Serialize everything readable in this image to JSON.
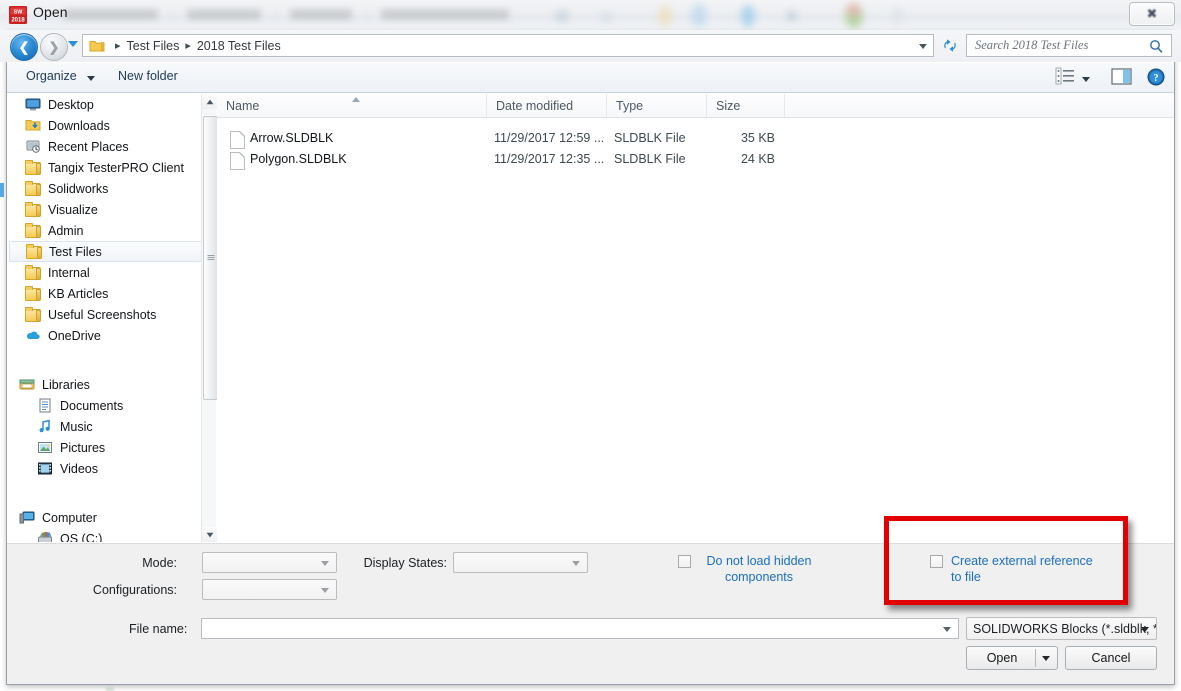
{
  "window": {
    "title": "Open",
    "title_icon": "solidworks-2018-icon",
    "close_label": "✖"
  },
  "address_bar": {
    "back_icon": "back-arrow-icon",
    "forward_icon": "forward-arrow-icon",
    "history_icon": "history-dropdown-icon",
    "folder_icon": "folder-icon",
    "separator": "▸",
    "crumbs": [
      "Test Files",
      "2018 Test Files"
    ],
    "refresh_icon": "refresh-icon",
    "search_placeholder": "Search 2018 Test Files",
    "search_icon": "search-icon"
  },
  "toolbar": {
    "organize_label": "Organize",
    "organize_caret_icon": "chevron-down-icon",
    "new_folder_label": "New folder",
    "view_icon": "view-list-icon",
    "view_caret_icon": "chevron-down-icon",
    "preview_pane_icon": "preview-pane-icon",
    "help_icon": "help-icon"
  },
  "nav_pane": {
    "groups": [
      {
        "items": [
          {
            "label": "Desktop",
            "icon": "desktop-icon",
            "indent": 0,
            "selected": false
          },
          {
            "label": "Downloads",
            "icon": "downloads-folder-icon",
            "indent": 0,
            "selected": false
          },
          {
            "label": "Recent Places",
            "icon": "recent-places-icon",
            "indent": 0,
            "selected": false
          },
          {
            "label": "Tangix TesterPRO Client",
            "icon": "folder-icon",
            "indent": 0,
            "selected": false
          },
          {
            "label": "Solidworks",
            "icon": "folder-icon",
            "indent": 0,
            "selected": false
          },
          {
            "label": "Visualize",
            "icon": "folder-icon",
            "indent": 0,
            "selected": false
          },
          {
            "label": "Admin",
            "icon": "folder-icon",
            "indent": 0,
            "selected": false
          },
          {
            "label": "Test Files",
            "icon": "folder-icon",
            "indent": 0,
            "selected": true
          },
          {
            "label": "Internal",
            "icon": "folder-icon",
            "indent": 0,
            "selected": false
          },
          {
            "label": "KB Articles",
            "icon": "folder-icon",
            "indent": 0,
            "selected": false
          },
          {
            "label": "Useful Screenshots",
            "icon": "folder-icon",
            "indent": 0,
            "selected": false
          },
          {
            "label": "OneDrive",
            "icon": "onedrive-cloud-icon",
            "indent": 0,
            "selected": false
          }
        ]
      },
      {
        "items": [
          {
            "label": "Libraries",
            "icon": "libraries-icon",
            "indent": -1,
            "selected": false
          },
          {
            "label": "Documents",
            "icon": "documents-library-icon",
            "indent": 1,
            "selected": false
          },
          {
            "label": "Music",
            "icon": "music-library-icon",
            "indent": 1,
            "selected": false
          },
          {
            "label": "Pictures",
            "icon": "pictures-library-icon",
            "indent": 1,
            "selected": false
          },
          {
            "label": "Videos",
            "icon": "videos-library-icon",
            "indent": 1,
            "selected": false
          }
        ]
      },
      {
        "items": [
          {
            "label": "Computer",
            "icon": "computer-icon",
            "indent": -1,
            "selected": false
          },
          {
            "label": "OS (C:)",
            "icon": "hard-drive-icon",
            "indent": 1,
            "selected": false
          }
        ]
      }
    ],
    "scrollbar": {
      "up_icon": "scroll-up-icon",
      "down_icon": "scroll-down-icon"
    }
  },
  "file_list": {
    "columns": [
      {
        "label": "Name",
        "sorted": true
      },
      {
        "label": "Date modified",
        "sorted": false
      },
      {
        "label": "Type",
        "sorted": false
      },
      {
        "label": "Size",
        "sorted": false
      }
    ],
    "rows": [
      {
        "name": "Arrow.SLDBLK",
        "date_modified": "11/29/2017 12:59 ...",
        "type": "SLDBLK File",
        "size": "35 KB",
        "icon": "file-icon"
      },
      {
        "name": "Polygon.SLDBLK",
        "date_modified": "11/29/2017 12:35 ...",
        "type": "SLDBLK File",
        "size": "24 KB",
        "icon": "file-icon"
      }
    ]
  },
  "options": {
    "mode_label": "Mode:",
    "mode_value": "",
    "configurations_label": "Configurations:",
    "configurations_value": "",
    "display_states_label": "Display States:",
    "display_states_value": "",
    "do_not_load_hidden_label": "Do not load hidden components",
    "do_not_load_hidden_checked": false,
    "create_external_reference_label": "Create external reference to file",
    "create_external_reference_checked": false,
    "highlight_color": "#e20000"
  },
  "footer": {
    "file_name_label": "File name:",
    "file_name_value": "",
    "file_type_value": "SOLIDWORKS Blocks (*.sldblk, *",
    "open_label": "Open",
    "open_caret_icon": "chevron-down-icon",
    "cancel_label": "Cancel"
  }
}
